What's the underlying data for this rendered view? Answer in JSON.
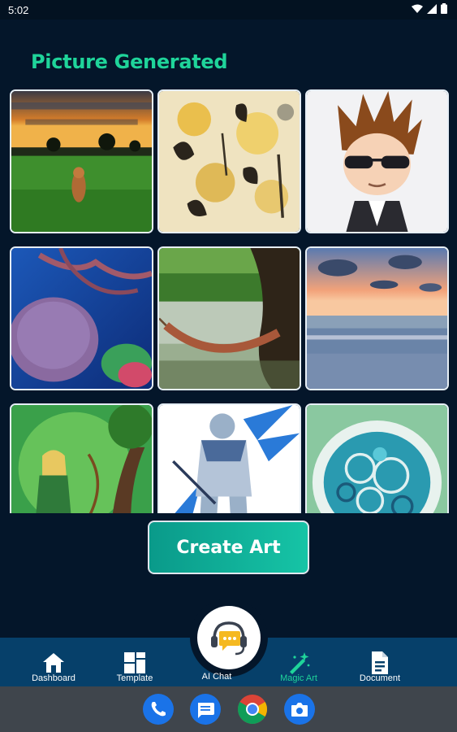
{
  "status_bar": {
    "time": "5:02",
    "icons": [
      "wifi-icon",
      "signal-icon",
      "battery-icon"
    ]
  },
  "page": {
    "title": "Picture Generated"
  },
  "gallery": {
    "items": [
      {
        "subject": "tiger-in-savanna-sunset"
      },
      {
        "subject": "floral-watercolor-pattern"
      },
      {
        "subject": "cartoon-boy-sunglasses"
      },
      {
        "subject": "coral-reef-underwater"
      },
      {
        "subject": "hammock-by-pond"
      },
      {
        "subject": "beach-sunset-clouds"
      },
      {
        "subject": "elf-archer-forest"
      },
      {
        "subject": "armored-warrior-sketch"
      },
      {
        "subject": "abstract-blue-ornament"
      }
    ]
  },
  "actions": {
    "create_art": "Create Art"
  },
  "bottom_nav": {
    "items": [
      {
        "label": "Dashboard",
        "icon": "home-icon"
      },
      {
        "label": "Template",
        "icon": "grid-icon"
      },
      {
        "label": "AI Chat",
        "icon": "headset-chat-icon"
      },
      {
        "label": "Magic Art",
        "icon": "magic-wand-icon",
        "active": true
      },
      {
        "label": "Document",
        "icon": "document-icon"
      }
    ]
  },
  "dock": {
    "apps": [
      "phone-icon",
      "messages-icon",
      "chrome-icon",
      "camera-icon"
    ]
  },
  "colors": {
    "accent": "#1fd49a",
    "background": "#04162a",
    "nav": "#06406a",
    "dock": "#3f454c"
  }
}
